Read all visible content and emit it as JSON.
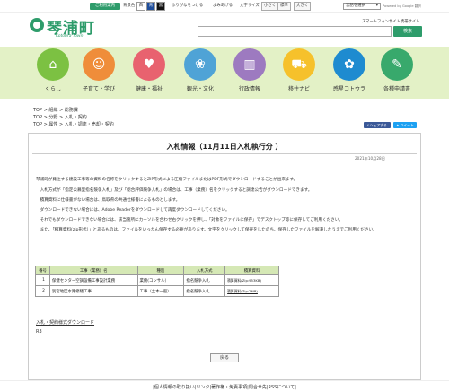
{
  "topbar": {
    "guide": "ご利用案内",
    "color_label": "背景色",
    "color_white": "白",
    "color_blue": "青",
    "color_black": "黒",
    "furigana": "ふりがなをつける",
    "readaloud": "よみあげる",
    "fontsize_label": "文字サイズ",
    "small": "小さく",
    "standard": "標準",
    "large": "大きく",
    "language": "言語を選択",
    "powered": "Powered by Google 翻訳"
  },
  "header": {
    "logo": "琴浦町",
    "logo_sub": "Kotoura Town",
    "smartphone": "スマートフォンサイト",
    "mobile": "携帯サイト",
    "search_button": "検索"
  },
  "nav": [
    {
      "label": "くらし",
      "icon": "house-icon",
      "glyph": "⌂",
      "color": "#7cc142"
    },
    {
      "label": "子育て・学び",
      "icon": "child-icon",
      "glyph": "☺",
      "color": "#ef8d3a"
    },
    {
      "label": "健康・福祉",
      "icon": "heart-hands-icon",
      "glyph": "♥",
      "color": "#e8626f"
    },
    {
      "label": "観光・文化",
      "icon": "leaf-icon",
      "glyph": "❀",
      "color": "#4fa3d6"
    },
    {
      "label": "行政情報",
      "icon": "building-icon",
      "glyph": "▥",
      "color": "#9d7ac0"
    },
    {
      "label": "移住ナビ",
      "icon": "truck-icon",
      "glyph": "⛟",
      "color": "#f6c12b"
    },
    {
      "label": "感星コトウラ",
      "icon": "globe-icon",
      "glyph": "✿",
      "color": "#1e8bd0"
    },
    {
      "label": "各種申請書",
      "icon": "document-icon",
      "glyph": "✎",
      "color": "#38a96c"
    }
  ],
  "breadcrumbs": [
    [
      "TOP",
      "組織",
      "総務課"
    ],
    [
      "TOP",
      "分野",
      "入札・契約"
    ],
    [
      "TOP",
      "属性",
      "入札・調達・売却・契約"
    ]
  ],
  "share": {
    "facebook": "シェアする",
    "twitter": "ツイート"
  },
  "page": {
    "title": "入札情報（11月11日入札執行分 ）",
    "date": "2021年10月28日",
    "paragraphs": [
      "琴浦町が発注する建設工事等の資料の名称をクリックするとZIP形式による圧縮ファイルまたはPDF形式でダウンロードすることが出来ます。",
      "　入札方式が「指定公募型指名競争入札」及び「総合評価競争入札」の場合は、工事（業務）名をクリックすると調達公告がダウンロードできます。",
      "　積算資料に仕様書がない場合は、鳥取県の共通仕様書によるものとします。",
      "　ダウンロードできない場合には、Adobe Readerをダウンロードして再度ダウンロードしてください。",
      "　それでもダウンロードできない場合には、該当箇所にカーソルを合わせ右クリックを押し、「対象をファイルに保存」でデスクトップ等に保存してご利用ください。",
      "　また、「積算資料(zip形式）」とあるものは、ファイルをいったん保存する必要があります。文字をクリックして保存をしたのち、保存したファイルを解凍したうえでご利用ください。"
    ],
    "table": {
      "headers": [
        "番号",
        "工事（業務）名",
        "種別",
        "入札方式",
        "積算資料"
      ],
      "rows": [
        [
          "1",
          "保健センター空調設備工事設計業務",
          "業務(コンサル）",
          "指名競争入札",
          "積算資料(Zip:953KB)"
        ],
        [
          "2",
          "別宮地区水路修繕工事",
          "工事（土木一般）",
          "指名競争入札",
          "積算資料(Zip:2MB)"
        ]
      ]
    },
    "download_link": "入札・契約様式ダウンロード",
    "code": "R3",
    "back_button": "戻る"
  },
  "footer": "|個人情報の取り扱い|リンク|著作権・免責事項|問合せ先|RSSについて|"
}
